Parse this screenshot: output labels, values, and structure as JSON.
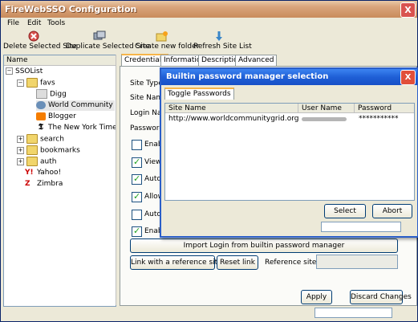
{
  "window": {
    "title": "FireWebSSO Configuration",
    "close": "X"
  },
  "menu": [
    "File",
    "Edit",
    "Tools"
  ],
  "toolbar": [
    {
      "label": "Delete Selected Site",
      "icon": "delete-icon"
    },
    {
      "label": "Duplicate Selected Site",
      "icon": "duplicate-icon"
    },
    {
      "label": "Create new folder",
      "icon": "new-folder-icon"
    },
    {
      "label": "Refresh Site List",
      "icon": "refresh-icon"
    }
  ],
  "tree": {
    "header": "Name",
    "nodes": [
      {
        "label": "SSOList",
        "expander": "−"
      },
      {
        "label": "favs",
        "expander": "−"
      },
      {
        "label": "Digg"
      },
      {
        "label": "World Community ..."
      },
      {
        "label": "Blogger"
      },
      {
        "label": "The New York Times"
      },
      {
        "label": "search",
        "expander": "+"
      },
      {
        "label": "bookmarks",
        "expander": "+"
      },
      {
        "label": "auth",
        "expander": "+"
      },
      {
        "label": "Yahoo!"
      },
      {
        "label": "Zimbra"
      }
    ]
  },
  "tabs": [
    "Credentials",
    "Information",
    "Description",
    "Advanced"
  ],
  "form": {
    "site_type": "Site Type :",
    "site_name": "Site Name",
    "login_name": "Login Name",
    "password": "Password :",
    "checks": [
      {
        "label": "Enable",
        "checked": false
      },
      {
        "label": "View in",
        "checked": true
      },
      {
        "label": "Auto s",
        "checked": true
      },
      {
        "label": "Allow s",
        "checked": true
      },
      {
        "label": "Auto lo",
        "checked": false
      },
      {
        "label": "Enable",
        "checked": true
      }
    ],
    "import_button": "Import Login from builtin password manager",
    "link_ref_button": "Link with a reference site",
    "reset_link_button": "Reset link",
    "reference_site_label": "Reference site:",
    "apply_button": "Apply",
    "discard_button": "Discard Changes"
  },
  "dialog": {
    "title": "Builtin password manager selection",
    "close": "X",
    "toggle_tab": "Toggle Passwords",
    "columns": [
      "Site Name",
      "User Name",
      "Password"
    ],
    "rows": [
      {
        "site": "http://www.worldcommunitygrid.org",
        "user": "",
        "password": "***********"
      }
    ],
    "select_button": "Select",
    "abort_button": "Abort"
  }
}
